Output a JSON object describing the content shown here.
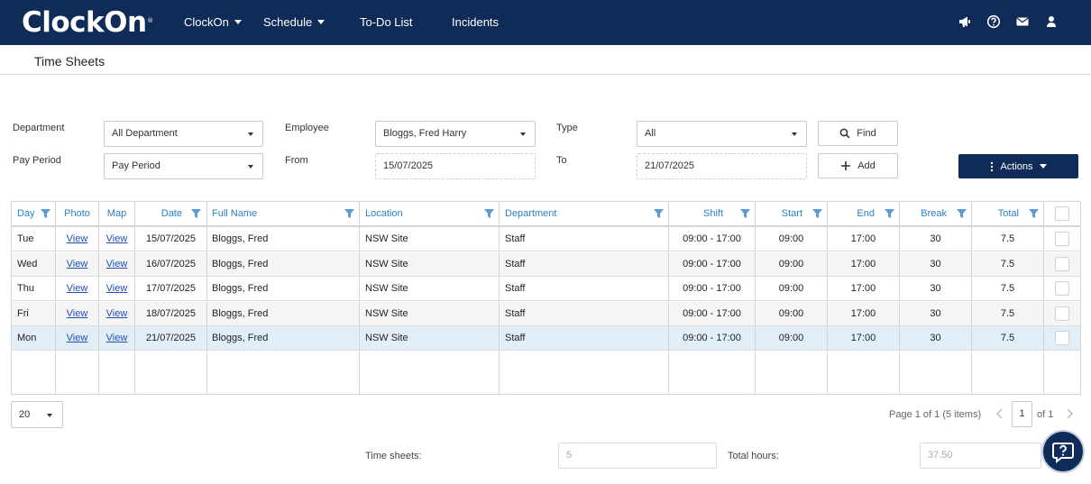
{
  "app": {
    "logo": "ClockOn"
  },
  "nav": {
    "clockon": "ClockOn",
    "schedule": "Schedule",
    "todo": "To-Do List",
    "incidents": "Incidents"
  },
  "page": {
    "title": "Time Sheets"
  },
  "filters": {
    "department": {
      "label": "Department",
      "value": "All Department"
    },
    "employee": {
      "label": "Employee",
      "value": "Bloggs, Fred Harry"
    },
    "type": {
      "label": "Type",
      "value": "All"
    },
    "pay_period": {
      "label": "Pay Period",
      "value": "Pay Period"
    },
    "from": {
      "label": "From",
      "value": "15/07/2025"
    },
    "to": {
      "label": "To",
      "value": "21/07/2025"
    },
    "find": "Find",
    "add": "Add",
    "actions": "Actions"
  },
  "grid": {
    "columns": {
      "day": "Day",
      "photo": "Photo",
      "map": "Map",
      "date": "Date",
      "full_name": "Full Name",
      "location": "Location",
      "department": "Department",
      "shift": "Shift",
      "start": "Start",
      "end": "End",
      "break": "Break",
      "total": "Total"
    },
    "rows": [
      {
        "day": "Tue",
        "photo": "View",
        "map": "View",
        "date": "15/07/2025",
        "full_name": "Bloggs, Fred",
        "location": "NSW Site",
        "department": "Staff",
        "shift": "09:00 - 17:00",
        "start": "09:00",
        "end": "17:00",
        "break": "30",
        "total": "7.5"
      },
      {
        "day": "Wed",
        "photo": "View",
        "map": "View",
        "date": "16/07/2025",
        "full_name": "Bloggs, Fred",
        "location": "NSW Site",
        "department": "Staff",
        "shift": "09:00 - 17:00",
        "start": "09:00",
        "end": "17:00",
        "break": "30",
        "total": "7.5"
      },
      {
        "day": "Thu",
        "photo": "View",
        "map": "View",
        "date": "17/07/2025",
        "full_name": "Bloggs, Fred",
        "location": "NSW Site",
        "department": "Staff",
        "shift": "09:00 - 17:00",
        "start": "09:00",
        "end": "17:00",
        "break": "30",
        "total": "7.5"
      },
      {
        "day": "Fri",
        "photo": "View",
        "map": "View",
        "date": "18/07/2025",
        "full_name": "Bloggs, Fred",
        "location": "NSW Site",
        "department": "Staff",
        "shift": "09:00 - 17:00",
        "start": "09:00",
        "end": "17:00",
        "break": "30",
        "total": "7.5"
      },
      {
        "day": "Mon",
        "photo": "View",
        "map": "View",
        "date": "21/07/2025",
        "full_name": "Bloggs, Fred",
        "location": "NSW Site",
        "department": "Staff",
        "shift": "09:00 - 17:00",
        "start": "09:00",
        "end": "17:00",
        "break": "30",
        "total": "7.5"
      }
    ]
  },
  "pager": {
    "page_size": "20",
    "info": "Page 1 of 1 (5 items)",
    "current": "1",
    "of": "of 1"
  },
  "summary": {
    "timesheets_label": "Time sheets:",
    "timesheets_value": "5",
    "hours_label": "Total hours:",
    "hours_value": "37.50"
  },
  "icons": [
    "megaphone-icon",
    "help-icon",
    "mail-icon",
    "user-icon",
    "search-icon",
    "plus-icon",
    "kebab-icon",
    "filter-icon",
    "chevron-left-icon",
    "chevron-right-icon",
    "question-icon"
  ]
}
